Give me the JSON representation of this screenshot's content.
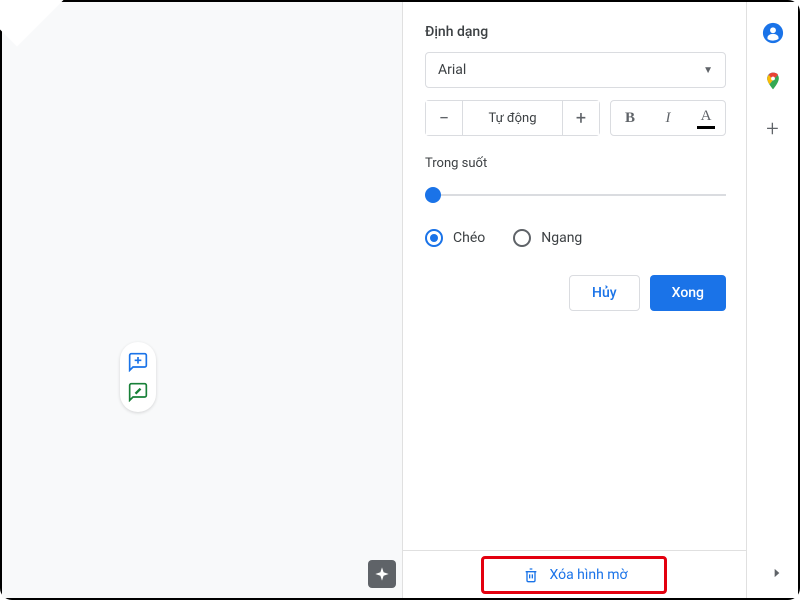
{
  "panel": {
    "format_heading": "Định dạng",
    "font_name": "Arial",
    "font_size_value": "Tự động",
    "transparency_label": "Trong suốt",
    "orientation": {
      "diagonal": "Chéo",
      "horizontal": "Ngang",
      "selected": "diagonal"
    },
    "cancel_label": "Hủy",
    "done_label": "Xong"
  },
  "footer": {
    "delete_watermark_label": "Xóa hình mờ"
  }
}
